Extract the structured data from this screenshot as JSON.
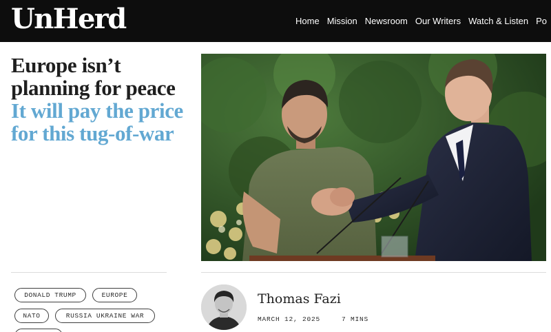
{
  "site": {
    "logo": "UnHerd"
  },
  "nav": {
    "items": [
      "Home",
      "Mission",
      "Newsroom",
      "Our Writers",
      "Watch & Listen",
      "Po"
    ]
  },
  "article": {
    "title": "Europe isn’t planning for peace",
    "subtitle": "It will pay the price for this tug-of-war",
    "tags": [
      "DONALD TRUMP",
      "EUROPE",
      "NATO",
      "RUSSIA UKRAINE WAR"
    ],
    "author": "Thomas Fazi",
    "date": "MARCH 12, 2025",
    "read_time": "7 MINS",
    "image_alt": "Two leaders shaking hands at an outdoor podium"
  },
  "colors": {
    "nav_background": "#0d0d0d",
    "subtitle_accent": "#62a8d2",
    "tag_border": "#3d3d3d"
  },
  "icons": {
    "avatar": "author-photo"
  }
}
